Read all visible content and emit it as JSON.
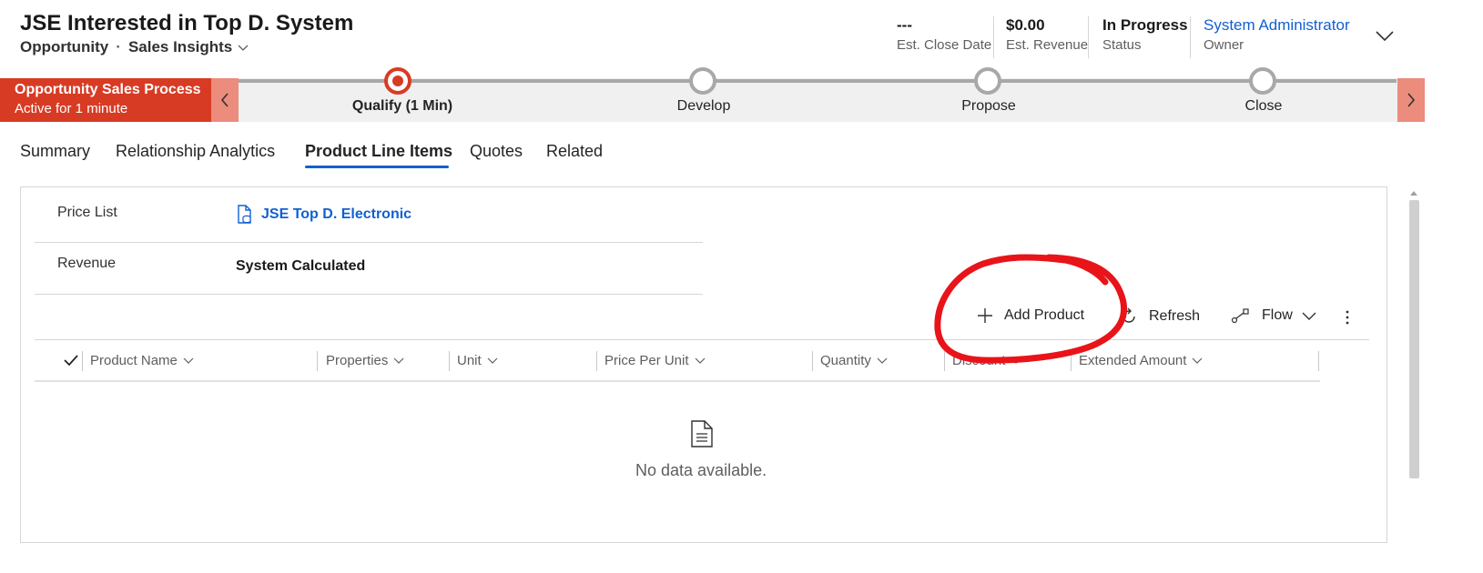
{
  "header": {
    "title": "JSE Interested in Top D. System",
    "entity": "Opportunity",
    "separator": "·",
    "form_selector": "Sales Insights",
    "fields": [
      {
        "value": "---",
        "label": "Est. Close Date"
      },
      {
        "value": "$0.00",
        "label": "Est. Revenue"
      },
      {
        "value": "In Progress",
        "label": "Status"
      },
      {
        "value": "System Administrator",
        "label": "Owner"
      }
    ]
  },
  "bpf": {
    "process_name": "Opportunity Sales Process",
    "active_time": "Active for 1 minute",
    "stages": [
      {
        "label": "Qualify  (1 Min)",
        "active": true
      },
      {
        "label": "Develop",
        "active": false
      },
      {
        "label": "Propose",
        "active": false
      },
      {
        "label": "Close",
        "active": false
      }
    ]
  },
  "tabs": [
    "Summary",
    "Relationship Analytics",
    "Product Line Items",
    "Quotes",
    "Related"
  ],
  "active_tab": "Product Line Items",
  "fields": {
    "price_list_label": "Price List",
    "price_list_value": "JSE Top D. Electronic",
    "revenue_label": "Revenue",
    "revenue_value": "System Calculated"
  },
  "commands": {
    "add_product": "Add Product",
    "refresh": "Refresh",
    "flow": "Flow"
  },
  "grid": {
    "columns": [
      "Product Name",
      "Properties",
      "Unit",
      "Price Per Unit",
      "Quantity",
      "Discount",
      "Extended Amount"
    ],
    "empty_message": "No data available."
  },
  "colors": {
    "accent": "#1160d1",
    "bpf_active": "#d83b24",
    "annotation": "#e8141a"
  }
}
